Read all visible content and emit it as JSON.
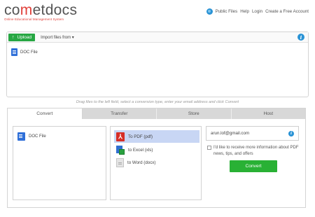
{
  "header": {
    "logo_prefix": "co",
    "logo_accent": "m",
    "logo_suffix": "etdocs",
    "logo_tagline": "Online Educational Management System",
    "nav": [
      "Public Files",
      "Help",
      "Login",
      "Create a Free Account"
    ]
  },
  "upload": {
    "button_label": "Upload",
    "import_label": "Import files from ▾",
    "file_name": "DOC File"
  },
  "hint_text": "Drag files to the left field, select a conversion type, enter your email address and click Convert",
  "tabs": [
    "Convert",
    "Transfer",
    "Store",
    "Host"
  ],
  "convert": {
    "source_file": "DOC File",
    "options": [
      {
        "label": "To PDF (pdf)",
        "icon": "pdf-icon",
        "selected": true
      },
      {
        "label": "to Excel (xls)",
        "icon": "excel-icon",
        "selected": false
      },
      {
        "label": "to Word (docx)",
        "icon": "word-icon",
        "selected": false
      }
    ],
    "email": "arun.lof@gmail.com",
    "newsletter_text": "I'd like to receive more information about PDF news, tips, and offers",
    "convert_button": "Convert"
  },
  "colors": {
    "accent_green": "#29b135",
    "info_blue": "#2a93d5",
    "logo_red": "#e0403a",
    "selection": "#c8d6f4"
  }
}
